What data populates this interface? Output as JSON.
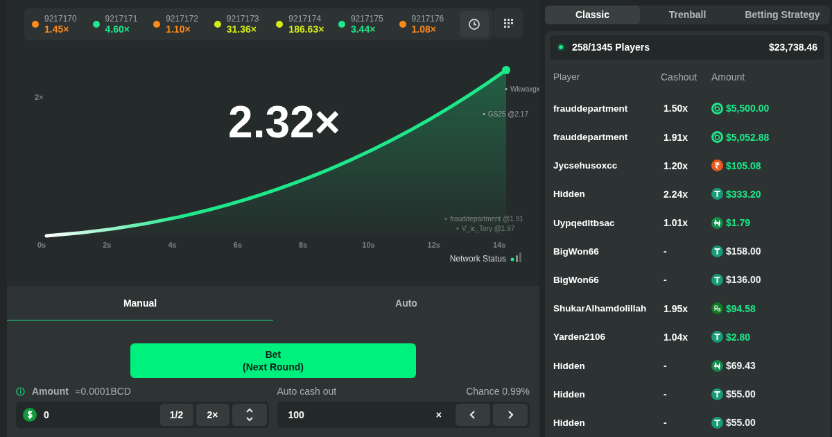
{
  "history": [
    {
      "round": "9217170",
      "multiplier": "1.45×",
      "color": "#ff8a1a"
    },
    {
      "round": "9217171",
      "multiplier": "4.60×",
      "color": "#1de88a"
    },
    {
      "round": "9217172",
      "multiplier": "1.10×",
      "color": "#ff8a1a"
    },
    {
      "round": "9217173",
      "multiplier": "31.36×",
      "color": "#d3ec17"
    },
    {
      "round": "9217174",
      "multiplier": "186.63×",
      "color": "#d3ec17"
    },
    {
      "round": "9217175",
      "multiplier": "3.44×",
      "color": "#1de88a"
    },
    {
      "round": "9217176",
      "multiplier": "1.08×",
      "color": "#ff8a1a"
    }
  ],
  "game": {
    "multiplier": "2.32×",
    "y_tick": "2×",
    "x_ticks": [
      "0s",
      "2s",
      "4s",
      "6s",
      "8s",
      "10s",
      "12s",
      "14s"
    ],
    "markers": [
      {
        "label": "Wkwaxgx",
        "faded": false
      },
      {
        "label": "GS25 @2.17",
        "faded": false
      },
      {
        "label": "frauddepartment @1.91",
        "faded": true
      },
      {
        "label": "V_ic_Tory @1.97",
        "faded": true
      }
    ],
    "network_label": "Network Status"
  },
  "bet_tabs": [
    {
      "label": "Manual",
      "selected": true
    },
    {
      "label": "Auto",
      "selected": false
    }
  ],
  "bet_button": {
    "line1": "Bet",
    "line2": "(Next Round)"
  },
  "amount": {
    "label": "Amount",
    "conversion": "≈0.0001BCD",
    "value": "0",
    "half": "1/2",
    "double": "2×"
  },
  "cashout": {
    "label": "Auto cash out",
    "chance": "Chance 0.99%",
    "value": "100",
    "suffix": "×"
  },
  "side_tabs": [
    {
      "label": "Classic",
      "selected": true
    },
    {
      "label": "Trenball",
      "selected": false
    },
    {
      "label": "Betting Strategy",
      "selected": false
    }
  ],
  "summary": {
    "players": "258/1345 Players",
    "total": "$23,738.46"
  },
  "columns": [
    "Player",
    "Cashout",
    "Amount"
  ],
  "rows": [
    {
      "player": "frauddepartment",
      "cashout": "1.50x",
      "amount": "$5,500.00",
      "won": true,
      "kind": "bc",
      "color": "#1de88a"
    },
    {
      "player": "frauddepartment",
      "cashout": "1.91x",
      "amount": "$5,052.88",
      "won": true,
      "kind": "bc",
      "color": "#1de88a"
    },
    {
      "player": "Jycsehusoxcc",
      "cashout": "1.20x",
      "amount": "$105.08",
      "won": true,
      "kind": "inr",
      "color": "#e8591a"
    },
    {
      "player": "Hidden",
      "cashout": "2.24x",
      "amount": "$333.20",
      "won": true,
      "kind": "usdt",
      "color": "#1a9b78"
    },
    {
      "player": "Uypqedltbsac",
      "cashout": "1.01x",
      "amount": "$1.79",
      "won": true,
      "kind": "ngn",
      "color": "#138a4a"
    },
    {
      "player": "BigWon66",
      "cashout": "-",
      "amount": "$158.00",
      "won": false,
      "kind": "usdt",
      "color": "#1a9b78"
    },
    {
      "player": "BigWon66",
      "cashout": "-",
      "amount": "$136.00",
      "won": false,
      "kind": "usdt",
      "color": "#1a9b78"
    },
    {
      "player": "ShukarAlhamdolillah",
      "cashout": "1.95x",
      "amount": "$94.58",
      "won": true,
      "kind": "pkr",
      "color": "#0f7a1f"
    },
    {
      "player": "Yarden2106",
      "cashout": "1.04x",
      "amount": "$2.80",
      "won": true,
      "kind": "usdt",
      "color": "#1a9b78"
    },
    {
      "player": "Hidden",
      "cashout": "-",
      "amount": "$69.43",
      "won": false,
      "kind": "ngn",
      "color": "#138a4a"
    },
    {
      "player": "Hidden",
      "cashout": "-",
      "amount": "$55.00",
      "won": false,
      "kind": "usdt",
      "color": "#1a9b78"
    },
    {
      "player": "Hidden",
      "cashout": "-",
      "amount": "$55.00",
      "won": false,
      "kind": "usdt",
      "color": "#1a9b78"
    }
  ]
}
